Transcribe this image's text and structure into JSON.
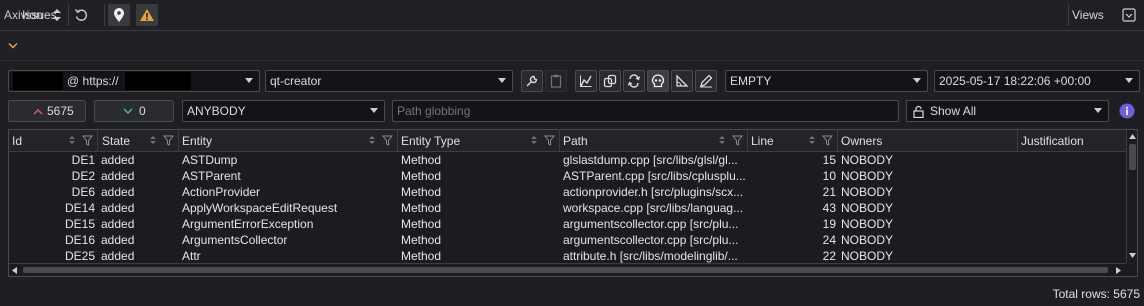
{
  "toolbar": {
    "plugin_select": "Axivion",
    "views_label": "Views",
    "colors": {
      "warning": "#e8a33c"
    }
  },
  "issues_header": {
    "title": "Issues"
  },
  "filters": {
    "dashboard_url_prefix": "@ https://",
    "project": "qt-creator",
    "version_select": "EMPTY",
    "date_select": "2025-05-17 18:22:06 +00:00",
    "added_count": "5675",
    "removed_count": "0",
    "owner_select": "ANYBODY",
    "path_placeholder": "Path globbing",
    "show_select": "Show All",
    "colors": {
      "added": "#e05a5a",
      "removed": "#4ec06a",
      "info": "#6b5fe0"
    }
  },
  "table": {
    "columns": [
      "Id",
      "State",
      "Entity",
      "Entity Type",
      "Path",
      "Line",
      "Owners",
      "Justification"
    ],
    "rows": [
      {
        "id": "DE1",
        "state": "added",
        "entity": "ASTDump",
        "type": "Method",
        "path": "glslastdump.cpp [src/libs/glsl/gl...",
        "line": "15",
        "owner": "NOBODY"
      },
      {
        "id": "DE2",
        "state": "added",
        "entity": "ASTParent",
        "type": "Method",
        "path": "ASTParent.cpp [src/libs/cplusplu...",
        "line": "10",
        "owner": "NOBODY"
      },
      {
        "id": "DE6",
        "state": "added",
        "entity": "ActionProvider",
        "type": "Method",
        "path": "actionprovider.h [src/plugins/scx...",
        "line": "21",
        "owner": "NOBODY"
      },
      {
        "id": "DE14",
        "state": "added",
        "entity": "ApplyWorkspaceEditRequest",
        "type": "Method",
        "path": "workspace.cpp [src/libs/languag...",
        "line": "43",
        "owner": "NOBODY"
      },
      {
        "id": "DE15",
        "state": "added",
        "entity": "ArgumentErrorException",
        "type": "Method",
        "path": "argumentscollector.cpp [src/plu...",
        "line": "19",
        "owner": "NOBODY"
      },
      {
        "id": "DE16",
        "state": "added",
        "entity": "ArgumentsCollector",
        "type": "Method",
        "path": "argumentscollector.cpp [src/plu...",
        "line": "24",
        "owner": "NOBODY"
      },
      {
        "id": "DE25",
        "state": "added",
        "entity": "Attr",
        "type": "Method",
        "path": "attribute.h [src/libs/modelinglib/...",
        "line": "22",
        "owner": "NOBODY"
      }
    ]
  },
  "status": {
    "total_rows": "Total rows: 5675"
  }
}
